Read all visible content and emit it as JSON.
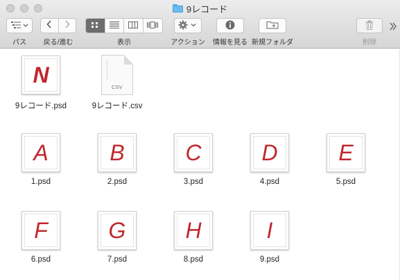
{
  "window": {
    "title": "9レコード"
  },
  "toolbar": {
    "path_label": "パス",
    "backforward_label": "戻る/進む",
    "view_label": "表示",
    "action_label": "アクション",
    "info_label": "情報を見る",
    "newfolder_label": "新規フォルダ",
    "delete_label": "削除",
    "view_modes": [
      "icon",
      "list",
      "column",
      "coverflow"
    ],
    "active_view": "icon"
  },
  "files": [
    {
      "name": "9レコード.psd",
      "kind": "psd",
      "letter": "N"
    },
    {
      "name": "9レコード.csv",
      "kind": "csv",
      "ext": "CSV"
    },
    {
      "name": "1.psd",
      "kind": "psd",
      "letter": "A"
    },
    {
      "name": "2.psd",
      "kind": "psd",
      "letter": "B"
    },
    {
      "name": "3.psd",
      "kind": "psd",
      "letter": "C"
    },
    {
      "name": "4.psd",
      "kind": "psd",
      "letter": "D"
    },
    {
      "name": "5.psd",
      "kind": "psd",
      "letter": "E"
    },
    {
      "name": "6.psd",
      "kind": "psd",
      "letter": "F"
    },
    {
      "name": "7.psd",
      "kind": "psd",
      "letter": "G"
    },
    {
      "name": "8.psd",
      "kind": "psd",
      "letter": "H"
    },
    {
      "name": "9.psd",
      "kind": "psd",
      "letter": "I"
    }
  ],
  "colors": {
    "letter": "#c1272d",
    "folder": "#6cbbf0",
    "active_segment": "#6d6d6d"
  }
}
